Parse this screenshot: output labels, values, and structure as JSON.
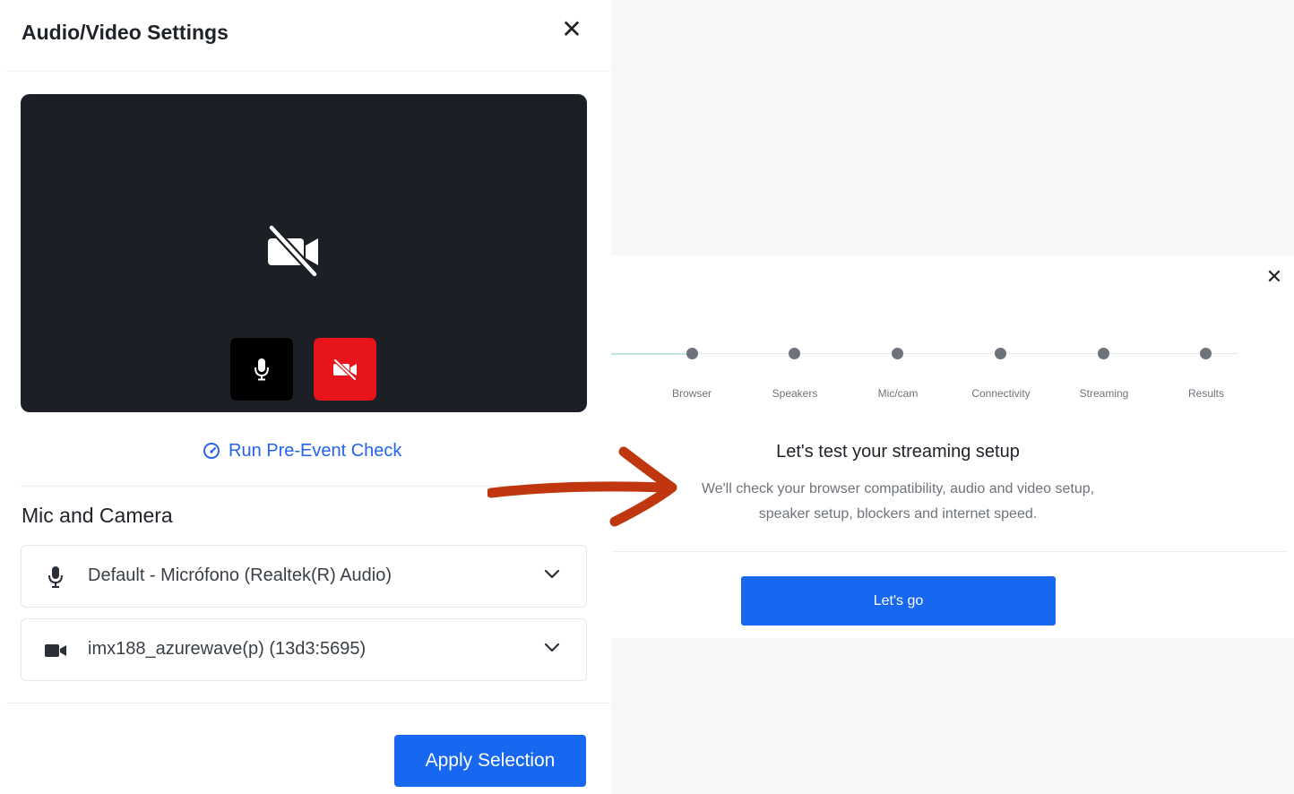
{
  "settings_dialog": {
    "title": "Audio/Video Settings",
    "close_icon": "close-icon",
    "preview": {
      "camera_state": "off",
      "mic_button": {
        "icon": "microphone-icon",
        "color": "#000000"
      },
      "camera_button": {
        "icon": "camera-off-icon",
        "color": "#e8141b"
      }
    },
    "pre_event_check": {
      "icon": "speedometer-icon",
      "label": "Run Pre-Event Check"
    },
    "section_title": "Mic and Camera",
    "mic_select": {
      "icon": "microphone-icon",
      "value": "Default - Micrófono (Realtek(R) Audio)"
    },
    "camera_select": {
      "icon": "video-camera-icon",
      "value": "imx188_azurewave(p) (13d3:5695)"
    },
    "apply_button": "Apply Selection",
    "accent_color": "#1867f0"
  },
  "arrow": {
    "color": "#c0360f"
  },
  "streaming_check": {
    "close_icon": "close-icon",
    "steps": [
      "Browser",
      "Speakers",
      "Mic/cam",
      "Connectivity",
      "Streaming",
      "Results"
    ],
    "heading": "Let's test your streaming setup",
    "description": "We'll check your browser compatibility, audio and video setup, speaker setup, blockers and internet speed.",
    "start_button": "Let's go"
  }
}
